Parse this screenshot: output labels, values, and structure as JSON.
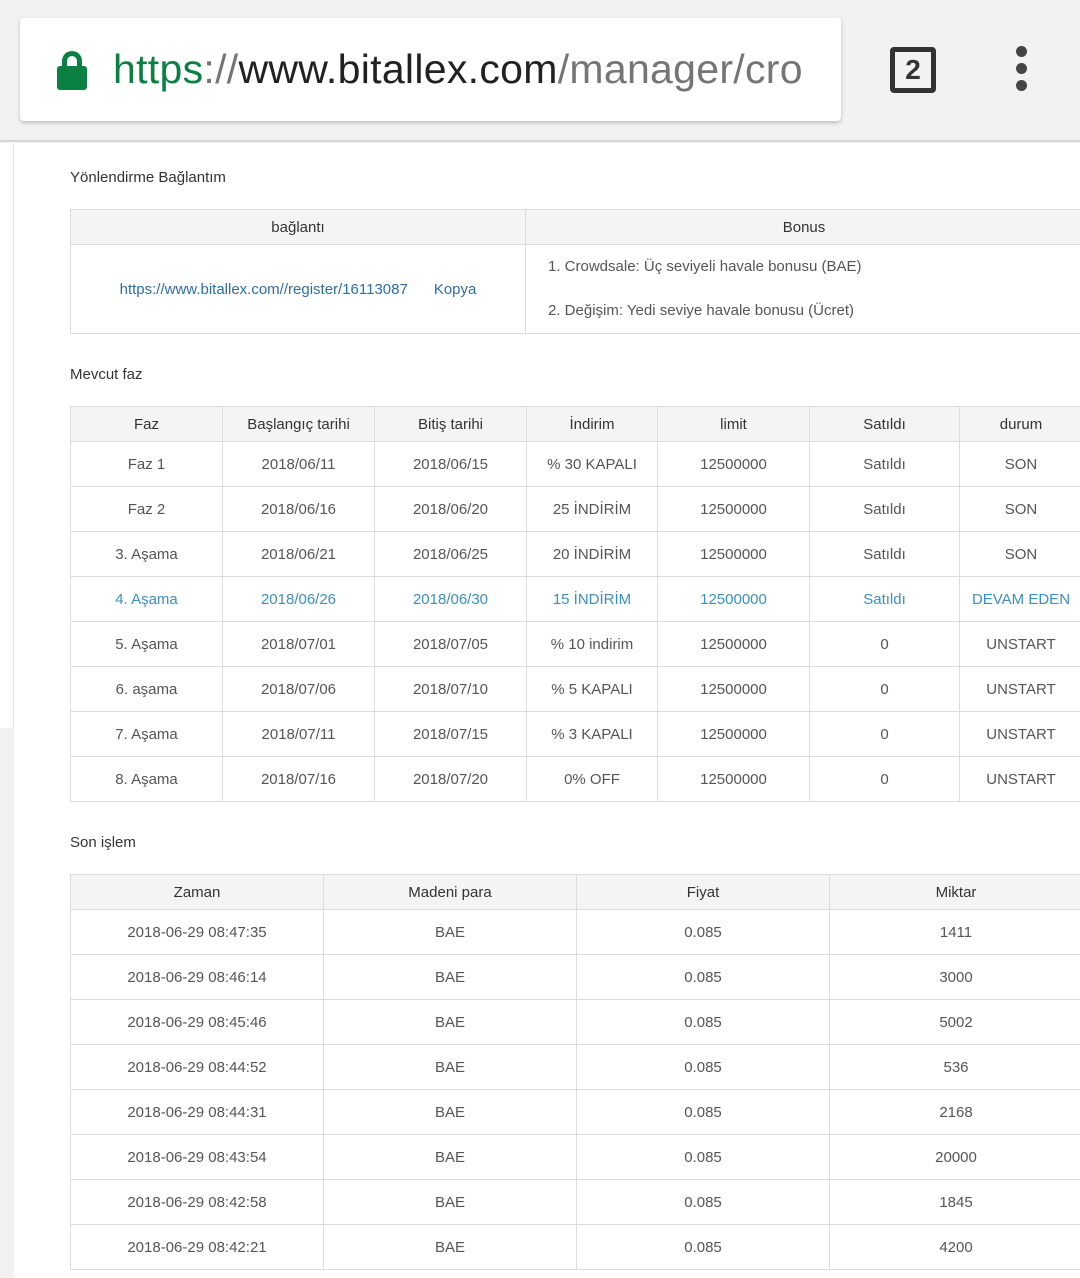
{
  "browser": {
    "url_scheme": "https",
    "url_sep": "://",
    "url_host": "www.bitallex.com",
    "url_path": "/manager/cro",
    "tab_count": "2"
  },
  "referral": {
    "title": "Yönlendirme Bağlantım",
    "col_link": "bağlantı",
    "col_bonus": "Bonus",
    "link": "https://www.bitallex.com//register/16113087",
    "copy": "Kopya",
    "bonus_1": "1. Crowdsale: Üç seviyeli havale bonusu (BAE)",
    "bonus_2": "2. Değişim: Yedi seviye havale bonusu (Ücret)"
  },
  "phase": {
    "title": "Mevcut faz",
    "headers": [
      "Faz",
      "Başlangıç tarihi",
      "Bitiş tarihi",
      "İndirim",
      "limit",
      "Satıldı",
      "durum"
    ],
    "rows": [
      [
        "Faz 1",
        "2018/06/11",
        "2018/06/15",
        "% 30 KAPALI",
        "12500000",
        "Satıldı",
        "SON"
      ],
      [
        "Faz 2",
        "2018/06/16",
        "2018/06/20",
        "25 İNDİRİM",
        "12500000",
        "Satıldı",
        "SON"
      ],
      [
        "3. Aşama",
        "2018/06/21",
        "2018/06/25",
        "20 İNDİRİM",
        "12500000",
        "Satıldı",
        "SON"
      ],
      [
        "4. Aşama",
        "2018/06/26",
        "2018/06/30",
        "15 İNDİRİM",
        "12500000",
        "Satıldı",
        "DEVAM EDEN"
      ],
      [
        "5. Aşama",
        "2018/07/01",
        "2018/07/05",
        "% 10 indirim",
        "12500000",
        "0",
        "UNSTART"
      ],
      [
        "6. aşama",
        "2018/07/06",
        "2018/07/10",
        "% 5 KAPALI",
        "12500000",
        "0",
        "UNSTART"
      ],
      [
        "7. Aşama",
        "2018/07/11",
        "2018/07/15",
        "% 3 KAPALI",
        "12500000",
        "0",
        "UNSTART"
      ],
      [
        "8. Aşama",
        "2018/07/16",
        "2018/07/20",
        "0% OFF",
        "12500000",
        "0",
        "UNSTART"
      ]
    ],
    "active_index": 3,
    "active_color": "#3a8fc4"
  },
  "trades": {
    "title": "Son işlem",
    "headers": [
      "Zaman",
      "Madeni para",
      "Fiyat",
      "Miktar"
    ],
    "rows": [
      [
        "2018-06-29 08:47:35",
        "BAE",
        "0.085",
        "1411"
      ],
      [
        "2018-06-29 08:46:14",
        "BAE",
        "0.085",
        "3000"
      ],
      [
        "2018-06-29 08:45:46",
        "BAE",
        "0.085",
        "5002"
      ],
      [
        "2018-06-29 08:44:52",
        "BAE",
        "0.085",
        "536"
      ],
      [
        "2018-06-29 08:44:31",
        "BAE",
        "0.085",
        "2168"
      ],
      [
        "2018-06-29 08:43:54",
        "BAE",
        "0.085",
        "20000"
      ],
      [
        "2018-06-29 08:42:58",
        "BAE",
        "0.085",
        "1845"
      ],
      [
        "2018-06-29 08:42:21",
        "BAE",
        "0.085",
        "4200"
      ]
    ]
  }
}
